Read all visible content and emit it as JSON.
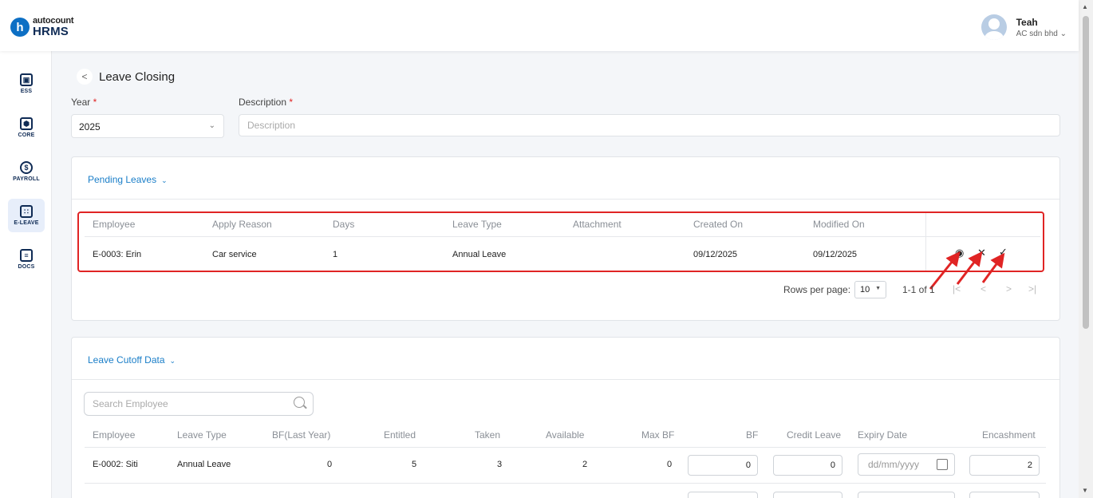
{
  "app": {
    "logo_small": "autocount",
    "logo_big": "HRMS",
    "logo_letter": "h"
  },
  "user": {
    "name": "Teah",
    "company": "AC sdn bhd ⌄"
  },
  "sidebar": {
    "items": [
      {
        "label": "ESS",
        "icon": "id-card-icon",
        "glyph": "▣"
      },
      {
        "label": "CORE",
        "icon": "cube-icon",
        "glyph": "⬢"
      },
      {
        "label": "PAYROLL",
        "icon": "dollar-icon",
        "glyph": "$"
      },
      {
        "label": "E-LEAVE",
        "icon": "calendar-icon",
        "glyph": "∷"
      },
      {
        "label": "DOCS",
        "icon": "document-icon",
        "glyph": "≡"
      }
    ]
  },
  "page": {
    "title": "Leave Closing",
    "year_label": "Year",
    "year_value": "2025",
    "description_label": "Description",
    "description_placeholder": "Description",
    "required_mark": "*"
  },
  "pending": {
    "heading": "Pending Leaves",
    "columns": [
      "Employee",
      "Apply Reason",
      "Days",
      "Leave Type",
      "Attachment",
      "Created On",
      "Modified On"
    ],
    "rows": [
      {
        "employee": "E-0003: Erin",
        "reason": "Car service",
        "days": "1",
        "leave_type": "Annual Leave",
        "attachment": "",
        "created": "09/12/2025",
        "modified": "09/12/2025"
      }
    ],
    "actions": {
      "view": "◉",
      "reject": "✕",
      "approve": "✓"
    },
    "rows_per_page_label": "Rows per page:",
    "rows_per_page": "10",
    "range": "1-1 of 1",
    "pager": {
      "first": "|<",
      "prev": "<",
      "next": ">",
      "last": ">|"
    }
  },
  "cutoff": {
    "heading": "Leave Cutoff Data",
    "search_placeholder": "Search Employee",
    "columns": [
      "Employee",
      "Leave Type",
      "BF(Last Year)",
      "Entitled",
      "Taken",
      "Available",
      "Max BF",
      "BF",
      "Credit Leave",
      "Expiry Date",
      "Encashment"
    ],
    "rows": [
      {
        "employee": "E-0002: Siti",
        "leave_type": "Annual Leave",
        "bf_last": "0",
        "entitled": "5",
        "taken": "3",
        "available": "2",
        "max_bf": "0",
        "bf": "0",
        "credit": "0",
        "expiry_placeholder": "dd/mm/yyyy",
        "encashment": "2"
      }
    ]
  },
  "colors": {
    "accent": "#1a7ec8",
    "highlight": "#e02424",
    "brand": "#0f2b55"
  }
}
